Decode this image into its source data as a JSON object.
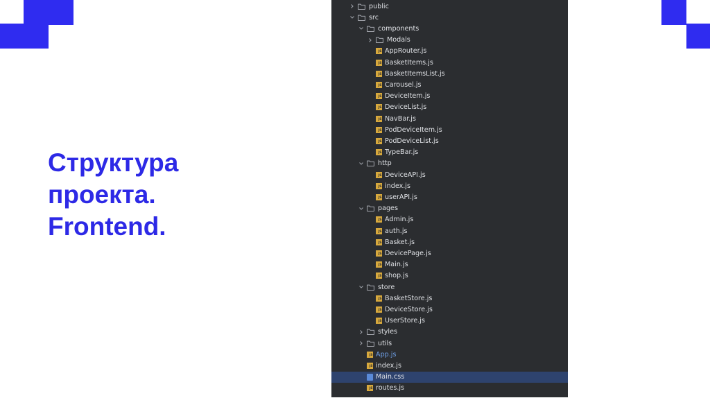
{
  "title": {
    "line1": "Структура",
    "line2": "проекта.",
    "line3": "Frontend."
  },
  "colors": {
    "accent": "#2f2cf0",
    "tree_bg": "#2b2d30",
    "js_icon": "#d8a93d",
    "selected": "#2e436e"
  },
  "tree": {
    "items": [
      {
        "label": "public",
        "icon": "folder-icon",
        "expanded": false,
        "depth": 0
      },
      {
        "label": "src",
        "icon": "folder-icon",
        "expanded": true,
        "depth": 0
      },
      {
        "label": "components",
        "icon": "folder-icon",
        "expanded": true,
        "depth": 1
      },
      {
        "label": "Modals",
        "icon": "folder-icon",
        "expanded": false,
        "depth": 2
      },
      {
        "label": "AppRouter.js",
        "icon": "js-file-icon",
        "depth": 2
      },
      {
        "label": "BasketItems.js",
        "icon": "js-file-icon",
        "depth": 2
      },
      {
        "label": "BasketItemsList.js",
        "icon": "js-file-icon",
        "depth": 2
      },
      {
        "label": "Carousel.js",
        "icon": "js-file-icon",
        "depth": 2
      },
      {
        "label": "DeviceItem.js",
        "icon": "js-file-icon",
        "depth": 2
      },
      {
        "label": "DeviceList.js",
        "icon": "js-file-icon",
        "depth": 2
      },
      {
        "label": "NavBar.js",
        "icon": "js-file-icon",
        "depth": 2
      },
      {
        "label": "PodDeviceItem.js",
        "icon": "js-file-icon",
        "depth": 2
      },
      {
        "label": "PodDeviceList.js",
        "icon": "js-file-icon",
        "depth": 2
      },
      {
        "label": "TypeBar.js",
        "icon": "js-file-icon",
        "depth": 2
      },
      {
        "label": "http",
        "icon": "folder-icon",
        "expanded": true,
        "depth": 1
      },
      {
        "label": "DeviceAPI.js",
        "icon": "js-file-icon",
        "depth": 2
      },
      {
        "label": "index.js",
        "icon": "js-file-icon",
        "depth": 2
      },
      {
        "label": "userAPI.js",
        "icon": "js-file-icon",
        "depth": 2
      },
      {
        "label": "pages",
        "icon": "folder-icon",
        "expanded": true,
        "depth": 1
      },
      {
        "label": "Admin.js",
        "icon": "js-file-icon",
        "depth": 2
      },
      {
        "label": "auth.js",
        "icon": "js-file-icon",
        "depth": 2
      },
      {
        "label": "Basket.js",
        "icon": "js-file-icon",
        "depth": 2
      },
      {
        "label": "DevicePage.js",
        "icon": "js-file-icon",
        "depth": 2
      },
      {
        "label": "Main.js",
        "icon": "js-file-icon",
        "depth": 2
      },
      {
        "label": "shop.js",
        "icon": "js-file-icon",
        "depth": 2
      },
      {
        "label": "store",
        "icon": "folder-icon",
        "expanded": true,
        "depth": 1
      },
      {
        "label": "BasketStore.js",
        "icon": "js-file-icon",
        "depth": 2
      },
      {
        "label": "DeviceStore.js",
        "icon": "js-file-icon",
        "depth": 2
      },
      {
        "label": "UserStore.js",
        "icon": "js-file-icon",
        "depth": 2
      },
      {
        "label": "styles",
        "icon": "folder-icon",
        "expanded": false,
        "depth": 1
      },
      {
        "label": "utils",
        "icon": "folder-icon",
        "expanded": false,
        "depth": 1
      },
      {
        "label": "App.js",
        "icon": "js-file-icon",
        "depth": 1,
        "highlighted": true
      },
      {
        "label": "index.js",
        "icon": "js-file-icon",
        "depth": 1
      },
      {
        "label": "Main.css",
        "icon": "css-file-icon",
        "depth": 1,
        "selected": true
      },
      {
        "label": "routes.js",
        "icon": "js-file-icon",
        "depth": 1
      }
    ]
  }
}
